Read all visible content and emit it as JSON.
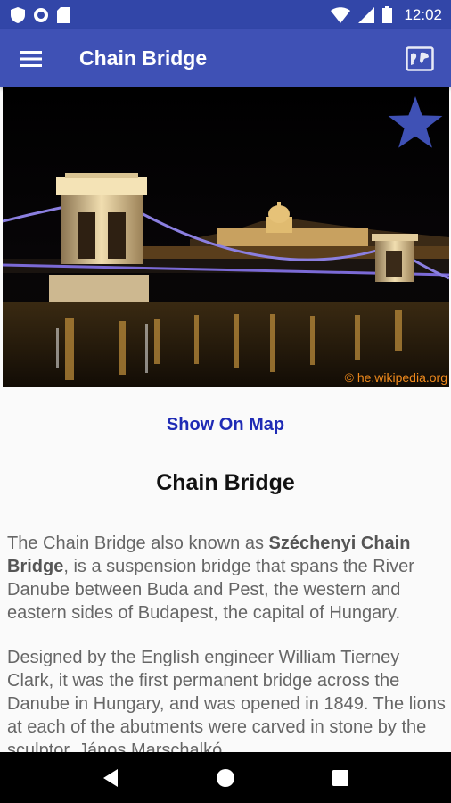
{
  "status_bar": {
    "time": "12:02",
    "icons": [
      "shield-icon",
      "circle-icon",
      "sd-card-icon",
      "wifi-icon",
      "signal-icon",
      "battery-icon"
    ],
    "color": "#3246a8"
  },
  "app_bar": {
    "title": "Chain Bridge",
    "color": "#3f51b5",
    "left_icon": "menu-icon",
    "right_icon": "map-icon"
  },
  "photo": {
    "credit": "© he.wikipedia.org",
    "favorite_icon": "star-icon"
  },
  "show_on_map_label": "Show On Map",
  "place_title": "Chain Bridge",
  "description": {
    "p1_before": "The Chain Bridge also known as ",
    "p1_bold": "Széchenyi Chain Bridge",
    "p1_after": ", is a suspension bridge that spans the River Danube between Buda and Pest, the western and eastern sides of Budapest, the capital of Hungary.",
    "p2": "Designed by the English engineer William Tierney Clark, it was the first permanent bridge across the Danube in Hungary, and was opened in 1849. The lions at each of the abutments were carved in stone by the sculptor, János Marschalkó."
  },
  "nav_bar": {
    "icons": [
      "back-icon",
      "home-icon",
      "recents-icon"
    ]
  }
}
